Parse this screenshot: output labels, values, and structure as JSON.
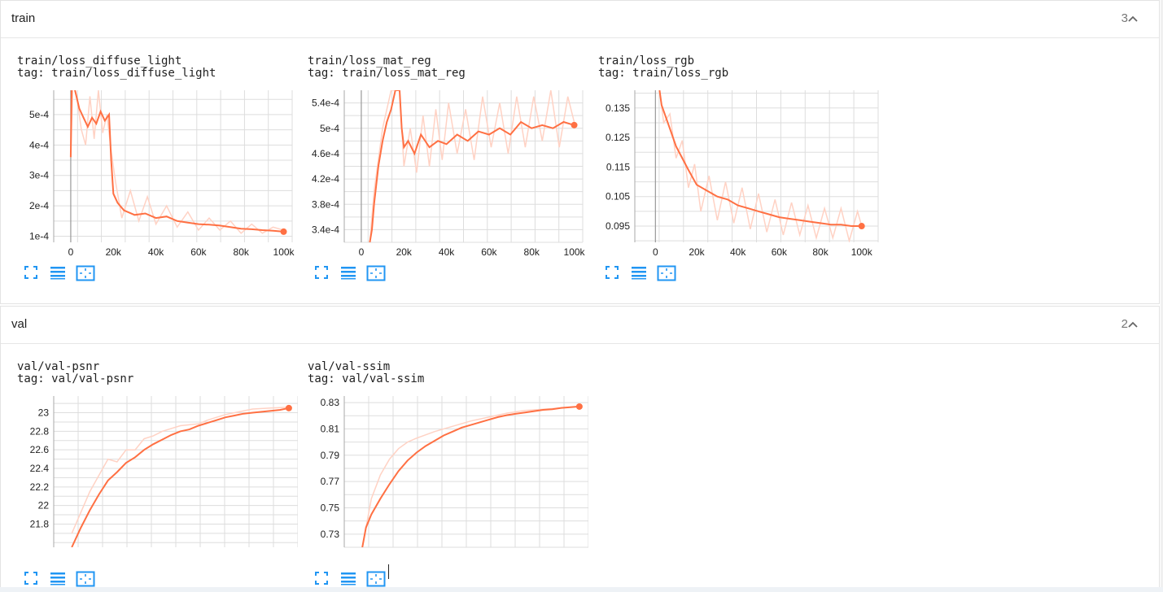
{
  "sections": [
    {
      "name": "train",
      "count": "3",
      "cards": [
        {
          "title": "train/loss_diffuse_light",
          "tag": "tag: train/loss_diffuse_light",
          "chart_data": {
            "type": "line",
            "xlim": [
              -8000,
              104000
            ],
            "ylim": [
              8e-05,
              0.00058
            ],
            "xticks": [
              0,
              20000,
              40000,
              60000,
              80000,
              100000
            ],
            "xtick_labels": [
              "0",
              "20k",
              "40k",
              "60k",
              "80k",
              "100k"
            ],
            "yticks": [
              0.0001,
              0.0002,
              0.0003,
              0.0004,
              0.0005
            ],
            "ytick_labels": [
              "1e-4",
              "2e-4",
              "3e-4",
              "4e-4",
              "5e-4"
            ],
            "grid": true,
            "colors": {
              "smoothed": "#ff7043",
              "raw": "#ffd2c4"
            },
            "smoothed": {
              "x": [
                0,
                500,
                1000,
                2000,
                4000,
                6000,
                8000,
                10000,
                12000,
                14000,
                16000,
                18000,
                19000,
                20000,
                22000,
                25000,
                30000,
                35000,
                40000,
                45000,
                50000,
                55000,
                60000,
                65000,
                70000,
                75000,
                80000,
                85000,
                90000,
                95000,
                100000
              ],
              "y": [
                0.00036,
                0.0006,
                0.0006,
                0.00058,
                0.00052,
                0.00049,
                0.00046,
                0.00049,
                0.00047,
                0.00051,
                0.00048,
                0.0005,
                0.00035,
                0.00024,
                0.00021,
                0.000185,
                0.00017,
                0.000175,
                0.00016,
                0.000165,
                0.00015,
                0.000145,
                0.00014,
                0.000138,
                0.000135,
                0.00013,
                0.000125,
                0.000123,
                0.00012,
                0.000118,
                0.000115
              ]
            },
            "raw": {
              "x": [
                0,
                1000,
                3000,
                5000,
                7000,
                9000,
                11000,
                13000,
                15000,
                17000,
                19000,
                21000,
                24000,
                28000,
                32000,
                36000,
                40000,
                45000,
                50000,
                55000,
                60000,
                65000,
                70000,
                75000,
                80000,
                85000,
                90000,
                95000,
                100000
              ],
              "y": [
                0.00036,
                0.0006,
                0.00055,
                0.00045,
                0.0004,
                0.00056,
                0.00042,
                0.00058,
                0.00044,
                0.0005,
                0.00038,
                0.00028,
                0.00016,
                0.00025,
                0.00015,
                0.00023,
                0.00014,
                0.0002,
                0.00013,
                0.00018,
                0.00012,
                0.00016,
                0.00012,
                0.00015,
                0.00011,
                0.00014,
                0.00011,
                0.00013,
                0.00012
              ]
            }
          }
        },
        {
          "title": "train/loss_mat_reg",
          "tag": "tag: train/loss_mat_reg",
          "chart_data": {
            "type": "line",
            "xlim": [
              -8000,
              104000
            ],
            "ylim": [
              0.00032,
              0.00056
            ],
            "xticks": [
              0,
              20000,
              40000,
              60000,
              80000,
              100000
            ],
            "xtick_labels": [
              "0",
              "20k",
              "40k",
              "60k",
              "80k",
              "100k"
            ],
            "yticks": [
              0.00034,
              0.00038,
              0.00042,
              0.00046,
              0.0005,
              0.00054
            ],
            "ytick_labels": [
              "3.4e-4",
              "3.8e-4",
              "4.2e-4",
              "4.6e-4",
              "5e-4",
              "5.4e-4"
            ],
            "grid": true,
            "colors": {
              "smoothed": "#ff7043",
              "raw": "#ffd2c4"
            },
            "smoothed": {
              "x": [
                4000,
                5000,
                6000,
                8000,
                10000,
                12000,
                14000,
                16000,
                18000,
                19000,
                20000,
                22000,
                25000,
                28000,
                32000,
                36000,
                40000,
                45000,
                50000,
                55000,
                60000,
                65000,
                70000,
                75000,
                80000,
                85000,
                90000,
                95000,
                100000
              ],
              "y": [
                0.00032,
                0.00034,
                0.00038,
                0.00044,
                0.00048,
                0.00051,
                0.00053,
                0.00056,
                0.00056,
                0.0005,
                0.00047,
                0.00048,
                0.00046,
                0.00049,
                0.00047,
                0.00048,
                0.000475,
                0.00049,
                0.00048,
                0.000495,
                0.00049,
                0.0005,
                0.00049,
                0.00051,
                0.0005,
                0.000505,
                0.0005,
                0.00051,
                0.000505
              ]
            },
            "raw": {
              "x": [
                4000,
                6000,
                10000,
                14000,
                18000,
                20000,
                23000,
                26000,
                29000,
                32000,
                35000,
                38000,
                41000,
                45000,
                49000,
                53000,
                57000,
                61000,
                65000,
                69000,
                73000,
                77000,
                81000,
                85000,
                89000,
                93000,
                97000,
                100000
              ],
              "y": [
                0.00032,
                0.0004,
                0.0005,
                0.00056,
                0.00056,
                0.00044,
                0.0005,
                0.00043,
                0.00052,
                0.00044,
                0.00053,
                0.00045,
                0.00054,
                0.00046,
                0.00053,
                0.00045,
                0.00055,
                0.00047,
                0.00054,
                0.00046,
                0.00055,
                0.00047,
                0.00055,
                0.00048,
                0.00056,
                0.00047,
                0.00055,
                0.00051
              ]
            }
          }
        },
        {
          "title": "train/loss_rgb",
          "tag": "tag: train/loss_rgb",
          "chart_data": {
            "type": "line",
            "xlim": [
              -10000,
              108000
            ],
            "ylim": [
              0.0895,
              0.141
            ],
            "xticks": [
              0,
              20000,
              40000,
              60000,
              80000,
              100000
            ],
            "xtick_labels": [
              "0",
              "20k",
              "40k",
              "60k",
              "80k",
              "100k"
            ],
            "yticks": [
              0.095,
              0.105,
              0.115,
              0.125,
              0.135
            ],
            "ytick_labels": [
              "0.095",
              "0.105",
              "0.115",
              "0.125",
              "0.135"
            ],
            "grid": true,
            "colors": {
              "smoothed": "#ff7043",
              "raw": "#ffd2c4"
            },
            "smoothed": {
              "x": [
                2000,
                3000,
                5000,
                7000,
                10000,
                13000,
                16000,
                20000,
                25000,
                30000,
                35000,
                40000,
                45000,
                50000,
                55000,
                60000,
                65000,
                70000,
                75000,
                80000,
                85000,
                90000,
                95000,
                100000
              ],
              "y": [
                0.141,
                0.136,
                0.132,
                0.128,
                0.122,
                0.118,
                0.114,
                0.109,
                0.107,
                0.105,
                0.104,
                0.102,
                0.101,
                0.1,
                0.099,
                0.098,
                0.0975,
                0.097,
                0.0965,
                0.096,
                0.0955,
                0.0955,
                0.095,
                0.095
              ]
            },
            "raw": {
              "x": [
                2000,
                4000,
                7000,
                10000,
                13000,
                16000,
                19000,
                22000,
                26000,
                30000,
                34000,
                38000,
                42000,
                46000,
                50000,
                54000,
                58000,
                62000,
                66000,
                70000,
                74000,
                78000,
                82000,
                86000,
                90000,
                94000,
                98000,
                100000
              ],
              "y": [
                0.141,
                0.13,
                0.133,
                0.118,
                0.124,
                0.108,
                0.116,
                0.1,
                0.112,
                0.097,
                0.11,
                0.096,
                0.108,
                0.094,
                0.106,
                0.093,
                0.104,
                0.092,
                0.103,
                0.092,
                0.102,
                0.091,
                0.101,
                0.091,
                0.101,
                0.09,
                0.1,
                0.095
              ]
            }
          }
        }
      ]
    },
    {
      "name": "val",
      "count": "2",
      "cards": [
        {
          "title": "val/val-psnr",
          "tag": "tag: val/val-psnr",
          "chart_data": {
            "type": "line",
            "xlim": [
              0,
              13.5
            ],
            "ylim": [
              21.55,
              23.18
            ],
            "yticks": [
              21.8,
              22,
              22.2,
              22.4,
              22.6,
              22.8,
              23
            ],
            "ytick_labels": [
              "21.8",
              "22",
              "22.2",
              "22.4",
              "22.6",
              "22.8",
              "23"
            ],
            "grid": true,
            "colors": {
              "smoothed": "#ff7043",
              "raw": "#ffd2c4"
            },
            "smoothed": {
              "x": [
                1,
                1.5,
                2,
                2.5,
                3,
                3.5,
                4,
                4.5,
                5,
                5.5,
                6,
                6.5,
                7,
                7.5,
                8,
                8.5,
                9,
                9.5,
                10,
                10.5,
                11,
                11.5,
                12,
                12.5,
                13
              ],
              "y": [
                21.55,
                21.76,
                21.95,
                22.12,
                22.27,
                22.36,
                22.46,
                22.52,
                22.6,
                22.66,
                22.71,
                22.76,
                22.8,
                22.82,
                22.86,
                22.89,
                22.92,
                22.95,
                22.97,
                22.99,
                23.0,
                23.01,
                23.02,
                23.03,
                23.05
              ]
            },
            "raw": {
              "x": [
                1,
                2,
                3,
                3.5,
                4,
                4.5,
                5,
                5.5,
                6,
                7,
                8,
                8.5,
                9,
                9.5,
                10,
                11,
                12,
                13
              ],
              "y": [
                21.7,
                22.15,
                22.5,
                22.47,
                22.6,
                22.6,
                22.72,
                22.75,
                22.8,
                22.86,
                22.88,
                22.92,
                22.95,
                22.98,
                23.0,
                23.04,
                23.05,
                23.06
              ]
            }
          }
        },
        {
          "title": "val/val-ssim",
          "tag": "tag: val/val-ssim",
          "chart_data": {
            "type": "line",
            "xlim": [
              0,
              13.5
            ],
            "ylim": [
              0.72,
              0.835
            ],
            "yticks": [
              0.73,
              0.75,
              0.77,
              0.79,
              0.81,
              0.83
            ],
            "ytick_labels": [
              "0.73",
              "0.75",
              "0.77",
              "0.79",
              "0.81",
              "0.83"
            ],
            "grid": true,
            "colors": {
              "smoothed": "#ff7043",
              "raw": "#ffd2c4"
            },
            "smoothed": {
              "x": [
                1,
                1.2,
                1.5,
                2,
                2.5,
                3,
                3.5,
                4,
                4.5,
                5,
                5.5,
                6,
                6.5,
                7,
                7.5,
                8,
                8.5,
                9,
                9.5,
                10,
                10.5,
                11,
                11.5,
                12,
                12.5,
                13
              ],
              "y": [
                0.72,
                0.735,
                0.745,
                0.757,
                0.768,
                0.778,
                0.786,
                0.792,
                0.797,
                0.801,
                0.805,
                0.808,
                0.811,
                0.813,
                0.815,
                0.817,
                0.819,
                0.8205,
                0.8215,
                0.8225,
                0.8235,
                0.8245,
                0.825,
                0.826,
                0.8265,
                0.827
              ]
            },
            "raw": {
              "x": [
                1,
                1.5,
                2,
                2.5,
                3,
                3.5,
                4,
                5,
                6,
                7,
                8,
                9,
                10,
                11,
                12,
                13
              ],
              "y": [
                0.72,
                0.757,
                0.775,
                0.787,
                0.795,
                0.8,
                0.803,
                0.808,
                0.812,
                0.816,
                0.819,
                0.822,
                0.824,
                0.825,
                0.826,
                0.827
              ]
            }
          }
        }
      ]
    }
  ],
  "icons": [
    "fullscreen-icon",
    "toggle-lines-icon",
    "fit-domain-icon"
  ]
}
